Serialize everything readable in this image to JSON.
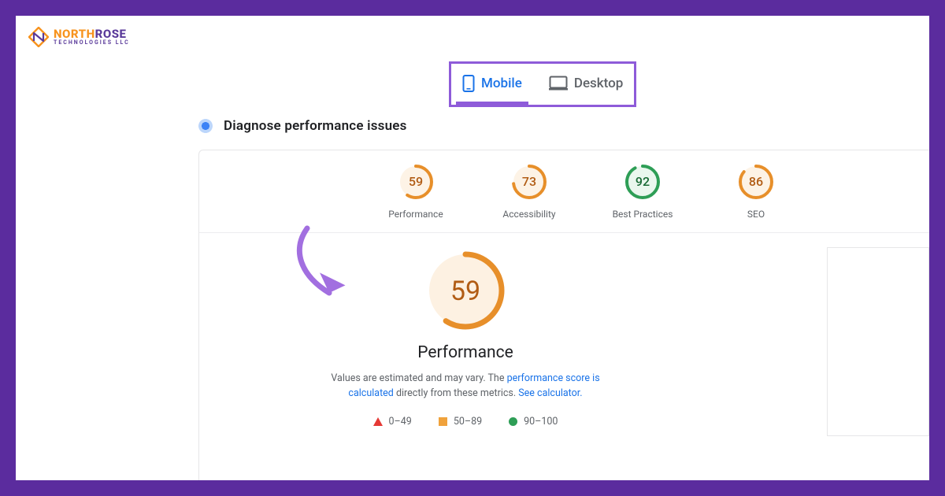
{
  "logo": {
    "name_part1": "NORTH",
    "name_part2": "ROSE",
    "subtitle": "TECHNOLOGIES LLC"
  },
  "tabs": {
    "mobile": "Mobile",
    "desktop": "Desktop"
  },
  "section": {
    "title": "Diagnose performance issues"
  },
  "gauges": {
    "performance": {
      "value": "59",
      "label": "Performance",
      "color": "#e78f2a",
      "pct": 59
    },
    "accessibility": {
      "value": "73",
      "label": "Accessibility",
      "color": "#e78f2a",
      "pct": 73
    },
    "best_practices": {
      "value": "92",
      "label": "Best Practices",
      "color": "#2e9e56",
      "pct": 92
    },
    "seo": {
      "value": "86",
      "label": "SEO",
      "color": "#e78f2a",
      "pct": 86
    }
  },
  "main": {
    "value": "59",
    "title": "Performance",
    "desc_prefix": "Values are estimated and may vary. The ",
    "desc_link1": "performance score is calculated",
    "desc_mid": " directly from these metrics. ",
    "desc_link2": "See calculator.",
    "color": "#e78f2a",
    "pct": 59
  },
  "legend": {
    "r0": "0–49",
    "r1": "50–89",
    "r2": "90–100"
  }
}
